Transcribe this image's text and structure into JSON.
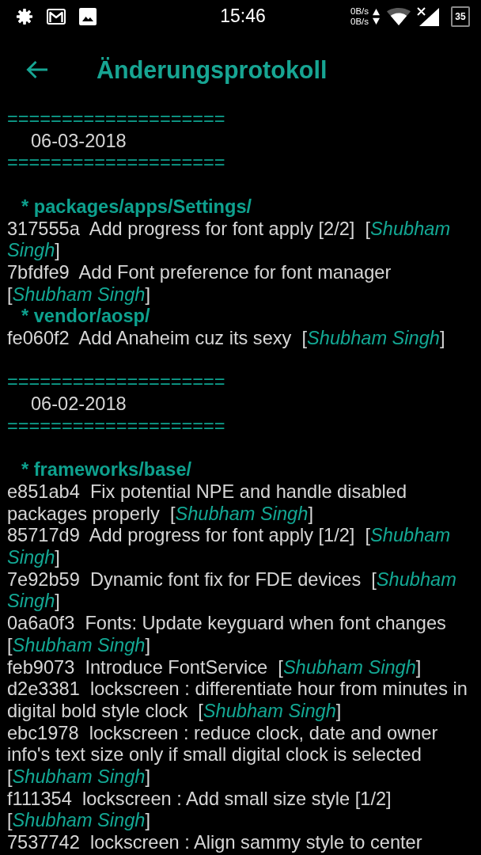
{
  "status_bar": {
    "time": "15:46",
    "upload_speed": "0B/s",
    "download_speed": "0B/s",
    "battery": "35"
  },
  "toolbar": {
    "title": "Änderungsprotokoll"
  },
  "sections": [
    {
      "rule_top": "====================",
      "date": "06-03-2018",
      "rule_bottom": "====================",
      "repos": [
        {
          "name": "* packages/apps/Settings/",
          "commits": [
            "317555a  Add progress for font apply [2/2]  [*Shubham Singh*]",
            "7bfdfe9  Add Font preference for font manager  [*Shubham Singh*]"
          ]
        },
        {
          "name": "* vendor/aosp/",
          "commits": [
            "fe060f2  Add Anaheim cuz its sexy  [*Shubham Singh*]"
          ]
        }
      ]
    },
    {
      "rule_top": "====================",
      "date": "06-02-2018",
      "rule_bottom": "====================",
      "repos": [
        {
          "name": "* frameworks/base/",
          "commits": [
            "e851ab4  Fix potential NPE and handle disabled packages properly  [*Shubham Singh*]",
            "85717d9  Add progress for font apply [1/2]  [*Shubham Singh*]",
            "7e92b59  Dynamic font fix for FDE devices  [*Shubham Singh*]",
            "0a6a0f3  Fonts: Update keyguard when font changes  [*Shubham Singh*]",
            "feb9073  Introduce FontService  [*Shubham Singh*]",
            "d2e3381  lockscreen : differentiate hour from minutes in digital bold style clock  [*Shubham Singh*]",
            "ebc1978  lockscreen : reduce clock, date and owner info's text size only if small digital clock is selected  [*Shubham Singh*]",
            "f111354  lockscreen : Add small size style [1/2]  [*Shubham Singh*]",
            "7537742  lockscreen : Align sammy style to center"
          ]
        }
      ]
    }
  ]
}
